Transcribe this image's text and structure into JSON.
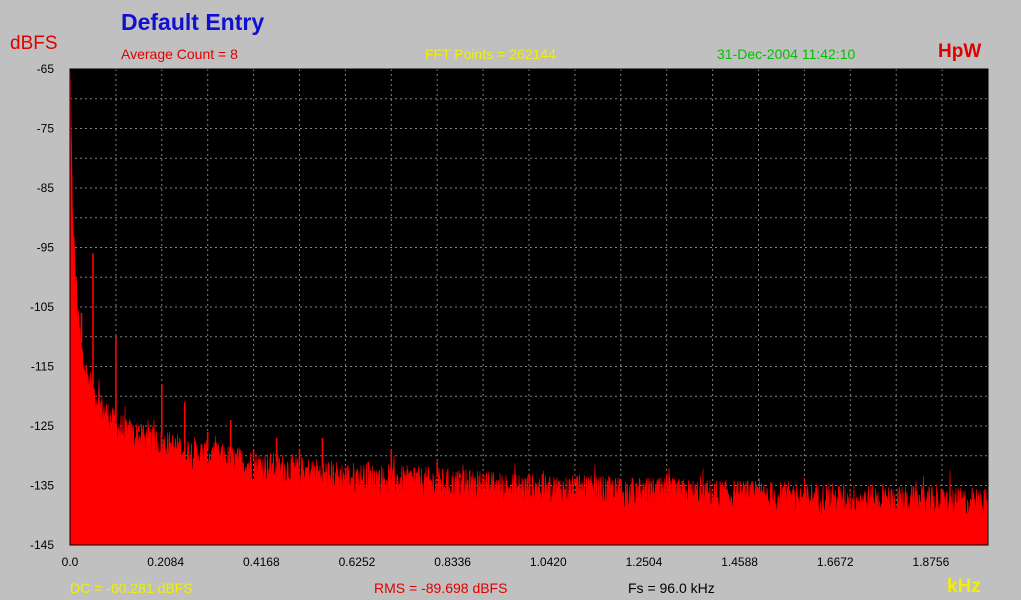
{
  "header": {
    "title": "Default Entry",
    "average_count": "Average Count = 8",
    "fft_points": "FFT Points = 262144",
    "timestamp": "31-Dec-2004 11:42:10",
    "brand": "HpW"
  },
  "footer": {
    "dc": "DC = -60.281 dBFS",
    "rms": "RMS = -89.698 dBFS",
    "fs": "Fs = 96.0 kHz"
  },
  "colors": {
    "background": "#c0c0c0",
    "plot_area": "#000000",
    "trace": "#ff0000",
    "grid": "#808080"
  },
  "chart_data": {
    "type": "area",
    "title": "Default Entry",
    "xlabel": "kHz",
    "ylabel": "dBFS",
    "xlim": [
      0,
      2.0
    ],
    "ylim": [
      -145,
      -65
    ],
    "grid": true,
    "x_ticks": [
      "0.0",
      "0.2084",
      "0.4168",
      "0.6252",
      "0.8336",
      "1.0420",
      "1.2504",
      "1.4588",
      "1.6672",
      "1.8756"
    ],
    "y_ticks": [
      "-65",
      "-75",
      "-85",
      "-95",
      "-105",
      "-115",
      "-125",
      "-135",
      "-145"
    ],
    "series": [
      {
        "x": [
          0.0,
          0.005,
          0.01,
          0.02,
          0.03,
          0.05,
          0.07,
          0.1,
          0.15,
          0.2,
          0.25,
          0.3,
          0.4,
          0.5,
          0.6,
          0.7,
          0.8,
          0.9,
          1.0,
          1.2,
          1.4,
          1.6,
          1.8,
          2.0
        ],
        "y": [
          -65,
          -88,
          -98,
          -110,
          -116,
          -120,
          -123,
          -126,
          -128,
          -129,
          -130,
          -131,
          -132.5,
          -133.5,
          -134.5,
          -135,
          -135.5,
          -136,
          -136.5,
          -137,
          -137.5,
          -138,
          -138.5,
          -139
        ]
      }
    ],
    "peaks": [
      {
        "x": 0.025,
        "y": -106
      },
      {
        "x": 0.05,
        "y": -96
      },
      {
        "x": 0.1,
        "y": -110
      },
      {
        "x": 0.15,
        "y": -125
      },
      {
        "x": 0.2,
        "y": -118
      },
      {
        "x": 0.25,
        "y": -121
      },
      {
        "x": 0.3,
        "y": -126
      },
      {
        "x": 0.35,
        "y": -124
      },
      {
        "x": 0.4,
        "y": -129
      },
      {
        "x": 0.45,
        "y": -127
      },
      {
        "x": 0.5,
        "y": -129
      },
      {
        "x": 0.55,
        "y": -127
      },
      {
        "x": 0.6,
        "y": -132
      },
      {
        "x": 0.65,
        "y": -131
      },
      {
        "x": 0.7,
        "y": -129
      },
      {
        "x": 0.75,
        "y": -132
      },
      {
        "x": 0.8,
        "y": -131
      },
      {
        "x": 0.85,
        "y": -133
      },
      {
        "x": 0.9,
        "y": -134
      },
      {
        "x": 1.0,
        "y": -133
      },
      {
        "x": 1.1,
        "y": -134
      },
      {
        "x": 1.2,
        "y": -134
      },
      {
        "x": 1.3,
        "y": -133
      }
    ]
  }
}
